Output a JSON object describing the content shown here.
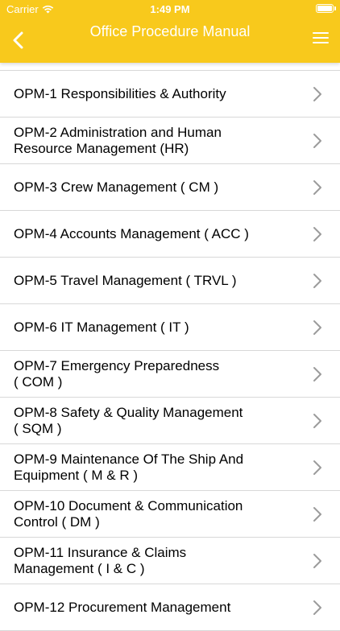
{
  "status_bar": {
    "carrier": "Carrier",
    "time": "1:49 PM"
  },
  "header": {
    "title": "Office Procedure Manual",
    "background_color": "#f8c91c"
  },
  "items": [
    {
      "label": "OPM-1  Responsibilities & Authority"
    },
    {
      "label": "OPM-2  Administration and Human\nResource Management (HR)"
    },
    {
      "label": "OPM-3  Crew Management ( CM )"
    },
    {
      "label": "OPM-4  Accounts Management ( ACC )"
    },
    {
      "label": "OPM-5  Travel Management ( TRVL )"
    },
    {
      "label": "OPM-6  IT Management ( IT )"
    },
    {
      "label": "OPM-7  Emergency Preparedness\n( COM )"
    },
    {
      "label": "OPM-8  Safety & Quality Management\n( SQM )"
    },
    {
      "label": "OPM-9  Maintenance Of The Ship And\nEquipment ( M & R )"
    },
    {
      "label": "OPM-10  Document & Communication\nControl ( DM )"
    },
    {
      "label": "OPM-11  Insurance & Claims\nManagement ( I & C )"
    },
    {
      "label": "OPM-12  Procurement Management"
    }
  ]
}
